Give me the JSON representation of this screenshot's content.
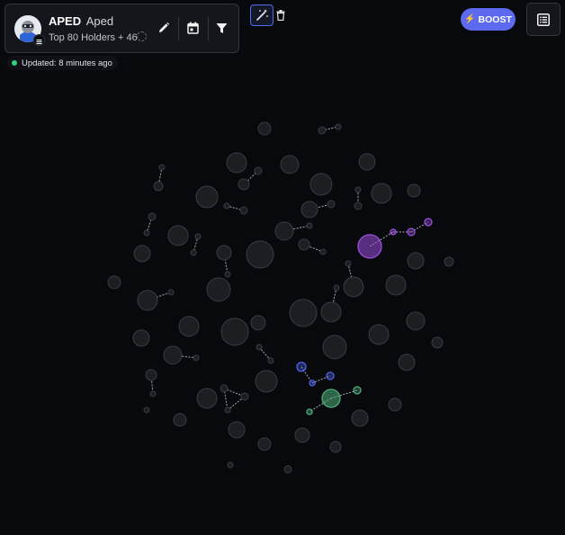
{
  "token": {
    "symbol": "APED",
    "name": "Aped",
    "holders_label": "Top 80 Holders + 46",
    "avatar_icon": "ape-avatar-icon",
    "chain_icon": "solana-chain-icon"
  },
  "toolbar": {
    "edit_icon": "pencil-icon",
    "calendar_icon": "calendar-icon",
    "filter_icon": "filter-icon",
    "magic_icon": "magic-wand-icon",
    "trash_icon": "trash-icon"
  },
  "status": {
    "updated_text": "Updated: 8 minutes ago",
    "live_color": "#2fd17a"
  },
  "boost": {
    "label": "BOOST",
    "color": "#5d6af0"
  },
  "list_icon": "list-icon",
  "colors": {
    "background": "#08090d",
    "bubble_fill": "#1d1e22",
    "bubble_stroke": "#3a3b40",
    "cluster_purple": "#9b4fe0",
    "cluster_blue": "#4f63e8",
    "cluster_green": "#4fae7a"
  }
}
